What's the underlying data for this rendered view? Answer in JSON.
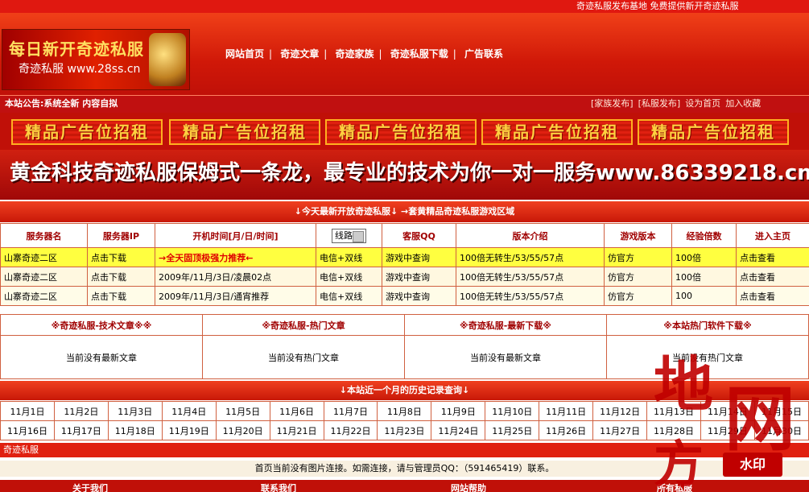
{
  "topbar": {
    "text": "奇迹私服发布基地  免费提供新开奇迹私服"
  },
  "logo": {
    "line1": "每日新开奇迹私服",
    "line2": "奇迹私服 www.28ss.cn"
  },
  "nav": [
    "网站首页",
    "奇迹文章",
    "奇迹家族",
    "奇迹私服下载",
    "广告联系"
  ],
  "notice": {
    "text": "本站公告:系统全新 内容自拟",
    "links": [
      "[家族发布]",
      "[私服发布]",
      "设为首页",
      "加入收藏"
    ]
  },
  "ads": [
    "精品广告位招租",
    "精品广告位招租",
    "精品广告位招租",
    "精品广告位招租",
    "精品广告位招租"
  ],
  "banner": {
    "text": "黄金科技奇迹私服保姆式一条龙，最专业的技术为你一对一服务www.86339218.cn"
  },
  "server_title": "↓今天最新开放奇迹私服↓  →套黄精品奇迹私服游戏区域",
  "server_table": {
    "headers": [
      "服务器名",
      "服务器IP",
      "开机时间[月/日/时间]",
      "线路",
      "客服QQ",
      "版本介绍",
      "游戏版本",
      "经验倍数",
      "进入主页"
    ],
    "rows": [
      [
        "山寨奇迹二区",
        "点击下载",
        "→全天固顶极强力推荐←",
        "电信+双线",
        "游戏中查询",
        "100倍无转生/53/55/57点",
        "仿官方",
        "100倍",
        "点击查看"
      ],
      [
        "山寨奇迹二区",
        "点击下载",
        "2009年/11月/3日/凌晨02点",
        "电信+双线",
        "游戏中查询",
        "100倍无转生/53/55/57点",
        "仿官方",
        "100倍",
        "点击查看"
      ],
      [
        "山寨奇迹二区",
        "点击下载",
        "2009年/11月/3日/通宵推荐",
        "电信+双线",
        "游戏中查询",
        "100倍无转生/53/55/57点",
        "仿官方",
        "100",
        "点击查看"
      ]
    ]
  },
  "articles": {
    "headers": [
      "※奇迹私服-技术文章※※",
      "※奇迹私服-热门文章",
      "※奇迹私服-最新下载※",
      "※本站热门软件下载※"
    ],
    "bodies": [
      "当前没有最新文章",
      "当前没有热门文章",
      "当前没有最新文章",
      "当前没有热门文章"
    ]
  },
  "history_title": "↓本站近一个月的历史记录查询↓",
  "days_row1": [
    "11月1日",
    "11月2日",
    "11月3日",
    "11月4日",
    "11月5日",
    "11月6日",
    "11月7日",
    "11月8日",
    "11月9日",
    "11月10日",
    "11月11日",
    "11月12日",
    "11月13日",
    "11月14日",
    "11月15日"
  ],
  "days_row2": [
    "11月16日",
    "11月17日",
    "11月18日",
    "11月19日",
    "11月20日",
    "11月21日",
    "11月22日",
    "11月23日",
    "11月24日",
    "11月25日",
    "11月26日",
    "11月27日",
    "11月28日",
    "11月29日",
    "11月30日"
  ],
  "footer_label": "奇迹私服",
  "link_notice": "首页当前没有图片连接。如需连接，请与管理员QQ：（591465419）联系。",
  "bottom_links": [
    "关于我们",
    "联系我们",
    "网站帮助",
    "所有私服"
  ],
  "watermark": {
    "chars": [
      "地",
      "方",
      "网"
    ],
    "box": "水印"
  }
}
